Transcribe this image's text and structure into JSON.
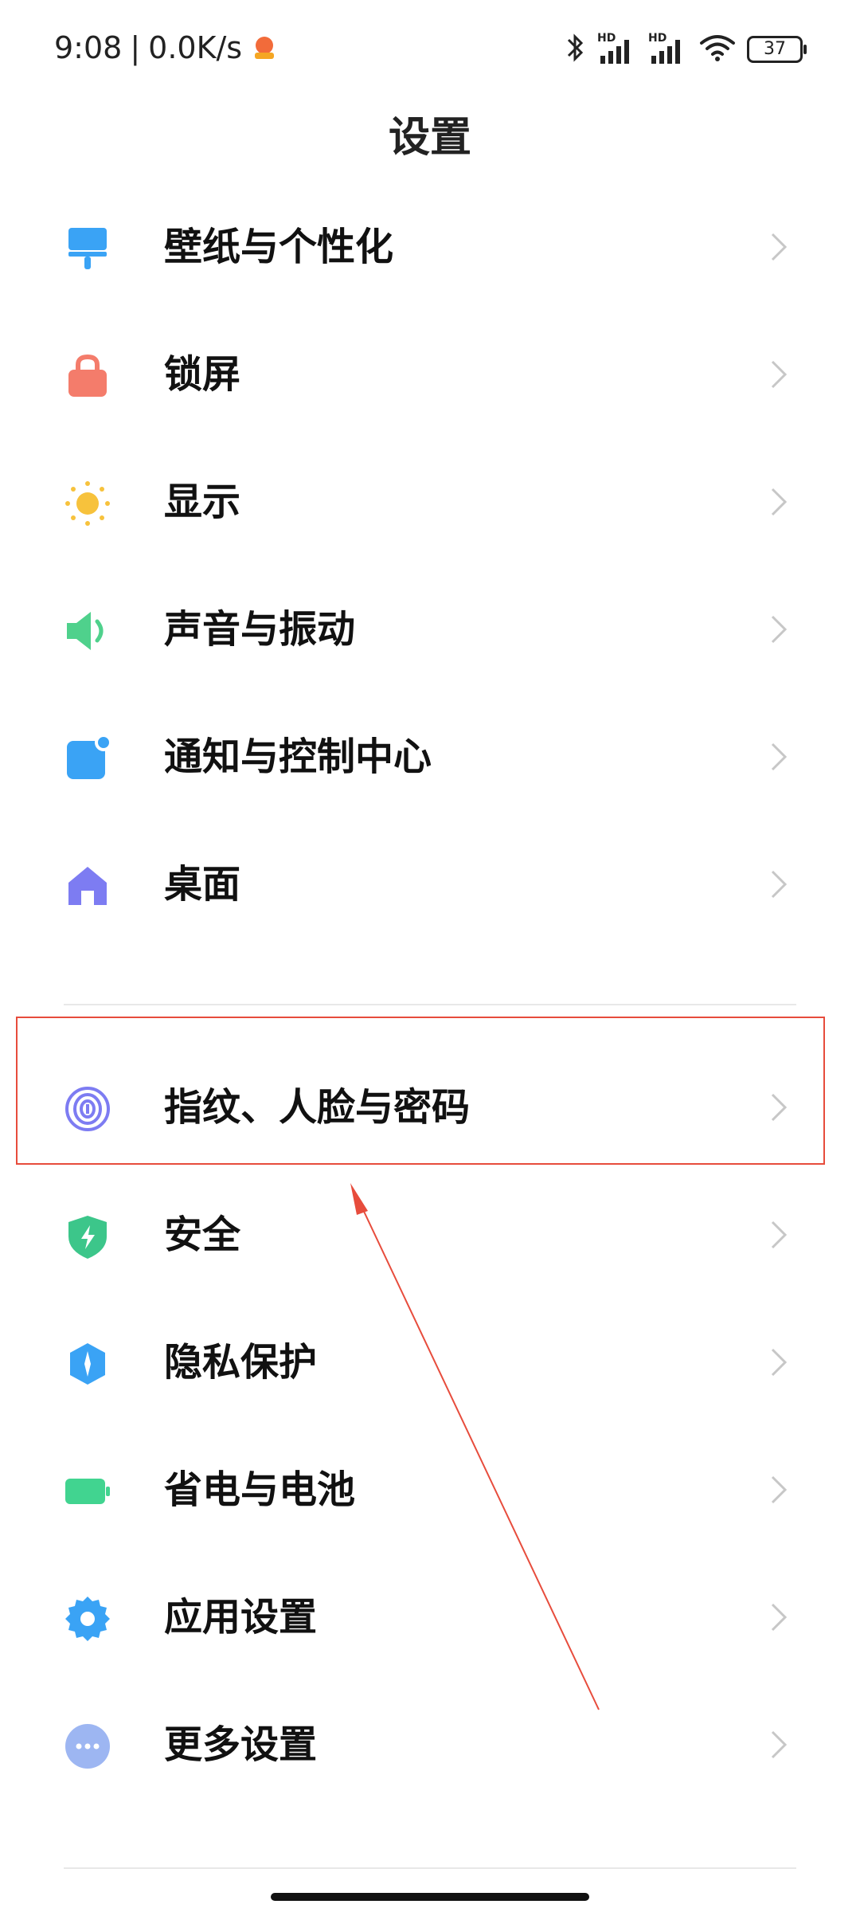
{
  "status_bar": {
    "time": "9:08",
    "separator": "|",
    "net_speed": "0.0K/s",
    "signal_1_label": "HD",
    "signal_2_label": "HD",
    "battery": "37"
  },
  "header": {
    "title": "设置"
  },
  "groups": [
    {
      "items": [
        {
          "label": "壁纸与个性化",
          "icon": "wallpaper-icon",
          "color": "#3AA3F5"
        },
        {
          "label": "锁屏",
          "icon": "lock-icon",
          "color": "#F47C6B"
        },
        {
          "label": "显示",
          "icon": "sun-icon",
          "color": "#F7C23C"
        },
        {
          "label": "声音与振动",
          "icon": "speaker-icon",
          "color": "#4FD18C"
        },
        {
          "label": "通知与控制中心",
          "icon": "notification-icon",
          "color": "#3AA3F5"
        },
        {
          "label": "桌面",
          "icon": "home-icon",
          "color": "#7D7CF2"
        }
      ]
    },
    {
      "items": [
        {
          "label": "指纹、人脸与密码",
          "icon": "fingerprint-icon",
          "color": "#7D7CF2",
          "highlighted": true
        },
        {
          "label": "安全",
          "icon": "shield-icon",
          "color": "#3CC68A"
        },
        {
          "label": "隐私保护",
          "icon": "privacy-icon",
          "color": "#3AA3F5"
        },
        {
          "label": "省电与电池",
          "icon": "battery-icon",
          "color": "#41D490"
        },
        {
          "label": "应用设置",
          "icon": "gear-icon",
          "color": "#3AA3F5"
        },
        {
          "label": "更多设置",
          "icon": "more-icon",
          "color": "#9DB6F2"
        }
      ]
    }
  ],
  "annotation": {
    "box_color": "#E74C3C",
    "arrow_color": "#E74C3C"
  }
}
